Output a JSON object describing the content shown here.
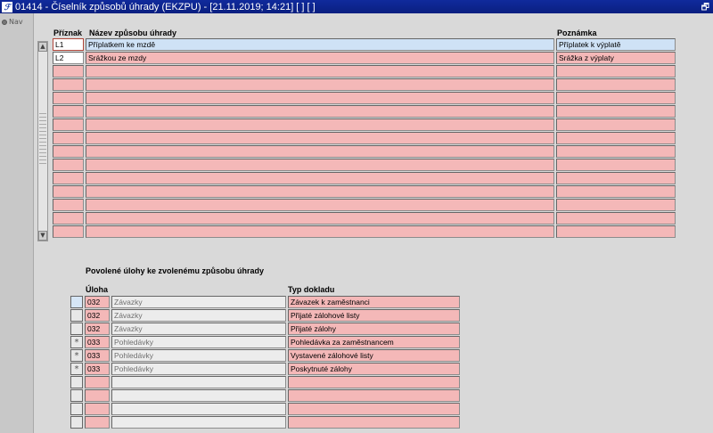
{
  "window": {
    "title": "01414 - Číselník způsobů úhrady (EKZPU) - [21.11.2019; 14:21]  [ ]  [ ]",
    "app_icon": "app-logo-icon",
    "restore_symbol": "🗗"
  },
  "nav": {
    "label": "Nav"
  },
  "grid1": {
    "headers": {
      "code": "Příznak",
      "name": "Název způsobu úhrady",
      "note": "Poznámka"
    },
    "rows": [
      {
        "code": "L1",
        "name": "Příplatkem ke mzdě",
        "note": "Příplatek k výplatě",
        "selected": true
      },
      {
        "code": "L2",
        "name": "Srážkou ze mzdy",
        "note": "Srážka z výplaty"
      },
      {
        "code": "",
        "name": "",
        "note": ""
      },
      {
        "code": "",
        "name": "",
        "note": ""
      },
      {
        "code": "",
        "name": "",
        "note": ""
      },
      {
        "code": "",
        "name": "",
        "note": ""
      },
      {
        "code": "",
        "name": "",
        "note": ""
      },
      {
        "code": "",
        "name": "",
        "note": ""
      },
      {
        "code": "",
        "name": "",
        "note": ""
      },
      {
        "code": "",
        "name": "",
        "note": ""
      },
      {
        "code": "",
        "name": "",
        "note": ""
      },
      {
        "code": "",
        "name": "",
        "note": ""
      },
      {
        "code": "",
        "name": "",
        "note": ""
      },
      {
        "code": "",
        "name": "",
        "note": ""
      },
      {
        "code": "",
        "name": "",
        "note": ""
      }
    ]
  },
  "grid2": {
    "section_title": "Povolené úlohy ke zvolenému způsobu úhrady",
    "headers": {
      "task": "Úloha",
      "doc": "Typ dokladu"
    },
    "rows": [
      {
        "mark": "",
        "code": "032",
        "task": "Závazky",
        "doc": "Závazek k zaměstnanci"
      },
      {
        "mark": "",
        "code": "032",
        "task": "Závazky",
        "doc": "Přijaté zálohové listy"
      },
      {
        "mark": "",
        "code": "032",
        "task": "Závazky",
        "doc": "Přijaté zálohy"
      },
      {
        "mark": "*",
        "code": "033",
        "task": "Pohledávky",
        "doc": "Pohledávka za zaměstnancem"
      },
      {
        "mark": "*",
        "code": "033",
        "task": "Pohledávky",
        "doc": "Vystavené zálohové listy"
      },
      {
        "mark": "*",
        "code": "033",
        "task": "Pohledávky",
        "doc": "Poskytnuté zálohy"
      },
      {
        "mark": "",
        "code": "",
        "task": "",
        "doc": ""
      },
      {
        "mark": "",
        "code": "",
        "task": "",
        "doc": ""
      },
      {
        "mark": "",
        "code": "",
        "task": "",
        "doc": ""
      },
      {
        "mark": "",
        "code": "",
        "task": "",
        "doc": ""
      }
    ]
  },
  "colors": {
    "row_bg": "#f4b8b8",
    "selected_row_bg": "#cfe2f6",
    "titlebar": "#0a1f80"
  }
}
